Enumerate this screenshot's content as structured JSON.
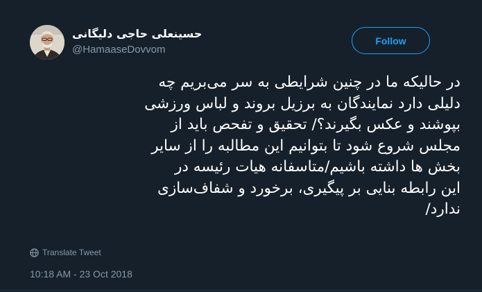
{
  "tweet": {
    "author": {
      "display_name": "حسینعلی حاجی دلیگانی",
      "handle": "@HamaaseDovvom"
    },
    "follow_label": "Follow",
    "text_lines": [
      "در حالیکه ما در چنین شرایطی به سر می‌بریم چه",
      "دلیلی دارد نمایندگان به برزیل بروند و لباس ورزشی",
      "بپوشند و عکس بگیرند؟/ تحقیق و تفحص باید از",
      "مجلس شروع شود تا بتوانیم این مطالبه را از سایر",
      "بخش ها داشته باشیم/متاسفانه هیات رئیسه در",
      "این رابطه بنایی بر پیگیری، برخورد و شفاف‌سازی",
      "ندارد/"
    ],
    "translate_label": "Translate Tweet",
    "timestamp": "10:18 AM - 23 Oct 2018"
  },
  "icons": {
    "avatar": "user-avatar-photo",
    "translate": "globe-icon"
  },
  "colors": {
    "background": "#15202b",
    "text": "#ffffff",
    "secondary_text": "#8899a6",
    "accent": "#1da1f2"
  }
}
